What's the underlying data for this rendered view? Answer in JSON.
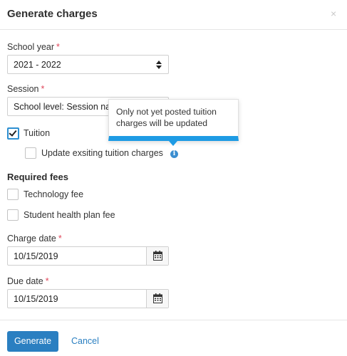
{
  "dialog": {
    "title": "Generate charges",
    "close_icon": "×"
  },
  "school_year": {
    "label": "School year",
    "required_mark": "*",
    "value": "2021 - 2022"
  },
  "session": {
    "label": "Session",
    "required_mark": "*",
    "value": "School level: Session nar"
  },
  "tuition": {
    "label": "Tuition",
    "checked": true,
    "update_existing_label": "Update exsiting tuition charges",
    "update_existing_checked": false,
    "info_icon": "i"
  },
  "tooltip": {
    "text": "Only not yet posted tuition charges will be updated"
  },
  "required_fees": {
    "title": "Required fees",
    "items": [
      {
        "label": "Technology fee",
        "checked": false
      },
      {
        "label": "Student health plan fee",
        "checked": false
      }
    ]
  },
  "charge_date": {
    "label": "Charge date",
    "required_mark": "*",
    "value": "10/15/2019"
  },
  "due_date": {
    "label": "Due date",
    "required_mark": "*",
    "value": "10/15/2019"
  },
  "footer": {
    "generate_label": "Generate",
    "cancel_label": "Cancel"
  },
  "colors": {
    "primary": "#2a7fc1",
    "accent": "#1e9be4",
    "required": "#e0465a"
  }
}
